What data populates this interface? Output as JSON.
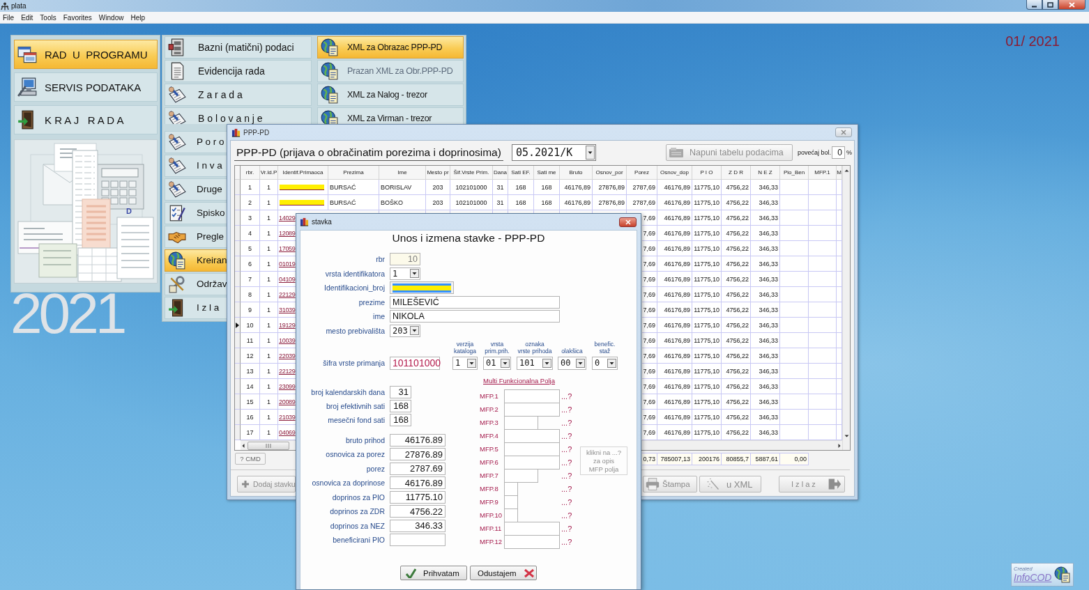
{
  "app_window": {
    "title": "plata",
    "menu": [
      "File",
      "Edit",
      "Tools",
      "Favorites",
      "Window",
      "Help"
    ]
  },
  "period": "01/ 2021",
  "main_menu": [
    {
      "label": "RAD  U  PROGRAMU",
      "selected": true
    },
    {
      "label": "SERVIS PODATAKA",
      "selected": false
    },
    {
      "label": "K R A J   R A D A",
      "selected": false
    }
  ],
  "illustration": {
    "letter": "D"
  },
  "year": "2021",
  "modules": [
    {
      "label": "Bazni (matični) podaci",
      "selected": false
    },
    {
      "label": "Evidencija rada",
      "selected": false
    },
    {
      "label": "Z a r a d a",
      "selected": false
    },
    {
      "label": "B o l o v a n j e",
      "selected": false
    },
    {
      "label": "P o r o",
      "selected": false
    },
    {
      "label": "I n v a",
      "selected": false
    },
    {
      "label": "Druge",
      "selected": false
    },
    {
      "label": "Spisko",
      "selected": false
    },
    {
      "label": "Pregle",
      "selected": false
    },
    {
      "label": "Kreiran",
      "selected": true
    },
    {
      "label": "Održav",
      "selected": false
    },
    {
      "label": "I z l a",
      "selected": false
    }
  ],
  "xml_menu": [
    {
      "label": "XML za Obrazac PPP-PD",
      "selected": true,
      "disabled": false
    },
    {
      "label": "Prazan XML za Obr.PPP-PD",
      "selected": false,
      "disabled": true
    },
    {
      "label": "XML za Nalog - trezor",
      "selected": false,
      "disabled": false
    },
    {
      "label": "XML za Virman - trezor",
      "selected": false,
      "disabled": false
    }
  ],
  "ppp_window": {
    "title": "PPP-PD",
    "heading": "PPP-PD (prijava o obračinatim porezima i doprinosima)",
    "period_select": "05.2021/K",
    "fill_button": {
      "label": "Napuni tabelu podacima",
      "disabled": true
    },
    "increase": {
      "label": "povećaj bol.",
      "value": "0",
      "unit": "%"
    },
    "table": {
      "columns": [
        "rbr.",
        "Vr.Id.P",
        "Identif.Primaoca",
        "Prezima",
        "Ime",
        "Mesto pr",
        "Šif.Vrste Prim.",
        "Dana",
        "Sati EF.",
        "Sati me",
        "Bruto",
        "Osnov_por",
        "Porez",
        "Osnov_dop",
        "P I O",
        "Z D R",
        "N E Z",
        "Pio_Ben",
        "MFP.1",
        "M"
      ],
      "rows": [
        {
          "selected": false,
          "redacted": true,
          "rbr": "1",
          "vr_id": "1",
          "prezima": "BURSAĆ",
          "ime": "BORISLAV",
          "mesto": "203",
          "sifra": "102101000",
          "dana": "31",
          "sati_ef": "168",
          "sati_me": "168",
          "bruto": "46176,89",
          "osnov_por": "27876,89",
          "porez": "2787,69",
          "osnov_dop": "46176,89",
          "pio": "11775,10",
          "zdr": "4756,22",
          "nez": "346,33"
        },
        {
          "selected": false,
          "redacted": true,
          "rbr": "2",
          "vr_id": "1",
          "prezima": "BURSAĆ",
          "ime": "BOŠKO",
          "mesto": "203",
          "sifra": "102101000",
          "dana": "31",
          "sati_ef": "168",
          "sati_me": "168",
          "bruto": "46176,89",
          "osnov_por": "27876,89",
          "porez": "2787,69",
          "osnov_dop": "46176,89",
          "pio": "11775,10",
          "zdr": "4756,22",
          "nez": "346,33"
        },
        {
          "selected": false,
          "redacted": false,
          "rbr": "3",
          "vr_id": "1",
          "identif": "14029",
          "porez": "7,69",
          "osnov_dop": "46176,89",
          "pio": "11775,10",
          "zdr": "4756,22",
          "nez": "346,33"
        },
        {
          "selected": false,
          "redacted": false,
          "rbr": "4",
          "vr_id": "1",
          "identif": "12089",
          "porez": "7,69",
          "osnov_dop": "46176,89",
          "pio": "11775,10",
          "zdr": "4756,22",
          "nez": "346,33"
        },
        {
          "selected": false,
          "redacted": false,
          "rbr": "5",
          "vr_id": "1",
          "identif": "17059",
          "porez": "7,69",
          "osnov_dop": "46176,89",
          "pio": "11775,10",
          "zdr": "4756,22",
          "nez": "346,33"
        },
        {
          "selected": false,
          "redacted": false,
          "rbr": "6",
          "vr_id": "1",
          "identif": "01019",
          "porez": "7,69",
          "osnov_dop": "46176,89",
          "pio": "11775,10",
          "zdr": "4756,22",
          "nez": "346,33"
        },
        {
          "selected": false,
          "redacted": false,
          "rbr": "7",
          "vr_id": "1",
          "identif": "04109",
          "porez": "7,69",
          "osnov_dop": "46176,89",
          "pio": "11775,10",
          "zdr": "4756,22",
          "nez": "346,33"
        },
        {
          "selected": false,
          "redacted": false,
          "rbr": "8",
          "vr_id": "1",
          "identif": "22129",
          "porez": "7,69",
          "osnov_dop": "46176,89",
          "pio": "11775,10",
          "zdr": "4756,22",
          "nez": "346,33"
        },
        {
          "selected": false,
          "redacted": false,
          "rbr": "9",
          "vr_id": "1",
          "identif": "31039",
          "porez": "7,69",
          "osnov_dop": "46176,89",
          "pio": "11775,10",
          "zdr": "4756,22",
          "nez": "346,33"
        },
        {
          "selected": true,
          "redacted": false,
          "rbr": "10",
          "vr_id": "1",
          "identif": "19129",
          "porez": "7,69",
          "osnov_dop": "46176,89",
          "pio": "11775,10",
          "zdr": "4756,22",
          "nez": "346,33"
        },
        {
          "selected": false,
          "redacted": false,
          "rbr": "11",
          "vr_id": "1",
          "identif": "10039",
          "porez": "7,69",
          "osnov_dop": "46176,89",
          "pio": "11775,10",
          "zdr": "4756,22",
          "nez": "346,33"
        },
        {
          "selected": false,
          "redacted": false,
          "rbr": "12",
          "vr_id": "1",
          "identif": "22039",
          "porez": "7,69",
          "osnov_dop": "46176,89",
          "pio": "11775,10",
          "zdr": "4756,22",
          "nez": "346,33"
        },
        {
          "selected": false,
          "redacted": false,
          "rbr": "13",
          "vr_id": "1",
          "identif": "22129",
          "porez": "7,69",
          "osnov_dop": "46176,89",
          "pio": "11775,10",
          "zdr": "4756,22",
          "nez": "346,33"
        },
        {
          "selected": false,
          "redacted": false,
          "rbr": "14",
          "vr_id": "1",
          "identif": "23099",
          "porez": "7,69",
          "osnov_dop": "46176,89",
          "pio": "11775,10",
          "zdr": "4756,22",
          "nez": "346,33"
        },
        {
          "selected": false,
          "redacted": false,
          "rbr": "15",
          "vr_id": "1",
          "identif": "20089",
          "porez": "7,69",
          "osnov_dop": "46176,89",
          "pio": "11775,10",
          "zdr": "4756,22",
          "nez": "346,33"
        },
        {
          "selected": false,
          "redacted": false,
          "rbr": "16",
          "vr_id": "1",
          "identif": "21039",
          "porez": "7,69",
          "osnov_dop": "46176,89",
          "pio": "11775,10",
          "zdr": "4756,22",
          "nez": "346,33"
        },
        {
          "selected": false,
          "redacted": false,
          "rbr": "17",
          "vr_id": "1",
          "identif": "04069",
          "porez": "7,69",
          "osnov_dop": "46176,89",
          "pio": "11775,10",
          "zdr": "4756,22",
          "nez": "346,33"
        }
      ]
    },
    "cmd_button": "? CMD",
    "totals": {
      "porez": "0,73",
      "osnov_dop": "785007,13",
      "pio": "200176",
      "zdr": "80855,7",
      "nez": "5887,61",
      "pio_ben": "0,00"
    },
    "buttons": [
      {
        "label": "Dodaj stavku"
      },
      {
        "label": "Štampa"
      },
      {
        "label": "u XML"
      },
      {
        "label": "I z l a z"
      }
    ]
  },
  "dialog": {
    "title": "stavka",
    "heading": "Unos i izmena stavke - PPP-PD",
    "fields": [
      {
        "label": "rbr",
        "kind": "readonly",
        "value": "10"
      },
      {
        "label": "vrsta identifikatora",
        "kind": "select",
        "value": "1"
      },
      {
        "label": "Identifikacioni_broj",
        "kind": "redacted"
      },
      {
        "label": "prezime",
        "kind": "text",
        "value": "MILEŠEVIĆ"
      },
      {
        "label": "ime",
        "kind": "text",
        "value": "NIKOLA"
      },
      {
        "label": "mesto prebivališta",
        "kind": "select",
        "value": "203"
      }
    ],
    "income_code": {
      "label": "šifra vrste primanja",
      "value": "101101000"
    },
    "code_selects": [
      {
        "heading": "verzija\nkataloga",
        "value": "1"
      },
      {
        "heading": "vrsta\nprim.prih.",
        "value": "01"
      },
      {
        "heading": "oznaka\nvrste prihoda",
        "value": "101"
      },
      {
        "heading": "olakšica",
        "value": "00"
      },
      {
        "heading": "benefic.\nstaž",
        "value": "0"
      }
    ],
    "hours": [
      {
        "label": "broj kalendarskih dana",
        "value": "31"
      },
      {
        "label": "broj efektivnih sati",
        "value": "168"
      },
      {
        "label": "mesečni fond sati",
        "value": "168"
      }
    ],
    "amounts": [
      {
        "label": "bruto prihod",
        "value": "46176.89"
      },
      {
        "label": "osnovica za porez",
        "value": "27876.89"
      },
      {
        "label": "porez",
        "value": "2787.69"
      },
      {
        "label": "osnovica za doprinose",
        "value": "46176.89"
      },
      {
        "label": "doprinos za PIO",
        "value": "11775.10"
      },
      {
        "label": "doprinos za ZDR",
        "value": "4756.22"
      },
      {
        "label": "doprinos za NEZ",
        "value": "346.33"
      },
      {
        "label": "beneficirani PIO"
      }
    ],
    "mfp_link": "Multi Funkcionalna Polja",
    "mfp": [
      {
        "label": "MFP.1",
        "kind": "wide",
        "help": "...?"
      },
      {
        "label": "MFP.2",
        "kind": "wide",
        "help": "...?"
      },
      {
        "label": "MFP.3",
        "kind": "medium",
        "help": "...?"
      },
      {
        "label": "MFP.4",
        "kind": "wide",
        "help": "...?"
      },
      {
        "label": "MFP.5",
        "kind": "wide",
        "help": "...?"
      },
      {
        "label": "MFP.6",
        "kind": "wide",
        "help": "...?"
      },
      {
        "label": "MFP.7",
        "kind": "medium",
        "help": "...?"
      },
      {
        "label": "MFP.8",
        "kind": "narrow",
        "help": "...?"
      },
      {
        "label": "MFP.9",
        "kind": "narrow",
        "help": "...?"
      },
      {
        "label": "MFP.10",
        "kind": "narrow",
        "help": "...?"
      },
      {
        "label": "MFP.11",
        "kind": "wide",
        "help": "...?"
      },
      {
        "label": "MFP.12",
        "kind": "wide",
        "help": "...?"
      }
    ],
    "mfp_hint": "klikni na ...?\nza opis\nMFP polja",
    "buttons": [
      {
        "label": "Prihvatam"
      },
      {
        "label": "Odustajem"
      }
    ]
  },
  "logo": {
    "tagline": "Created",
    "name": "InfoCOD"
  }
}
